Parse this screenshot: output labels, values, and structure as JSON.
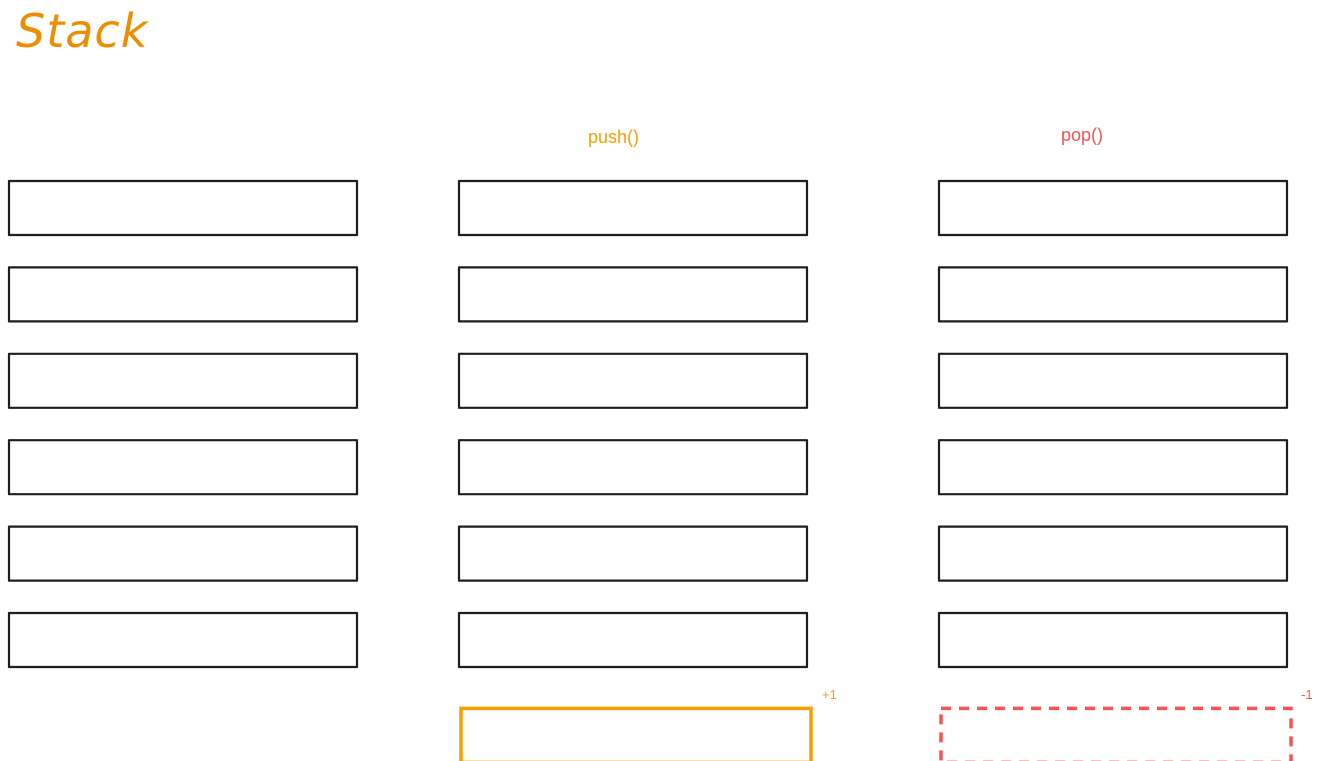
{
  "title": "Stack",
  "columns": {
    "push": {
      "label": "push()",
      "delta": "+1"
    },
    "pop": {
      "label": "pop()",
      "delta": "-1"
    }
  },
  "colors": {
    "title": "#f08c00",
    "push": "#f59f00",
    "pop": "#fa5252",
    "box_stroke": "#1e1e1e"
  },
  "stacks": [
    {
      "name": "stack-initial",
      "items": 6
    },
    {
      "name": "stack-push",
      "items": 6,
      "added": 1
    },
    {
      "name": "stack-pop",
      "items": 6,
      "removed": 1
    }
  ]
}
